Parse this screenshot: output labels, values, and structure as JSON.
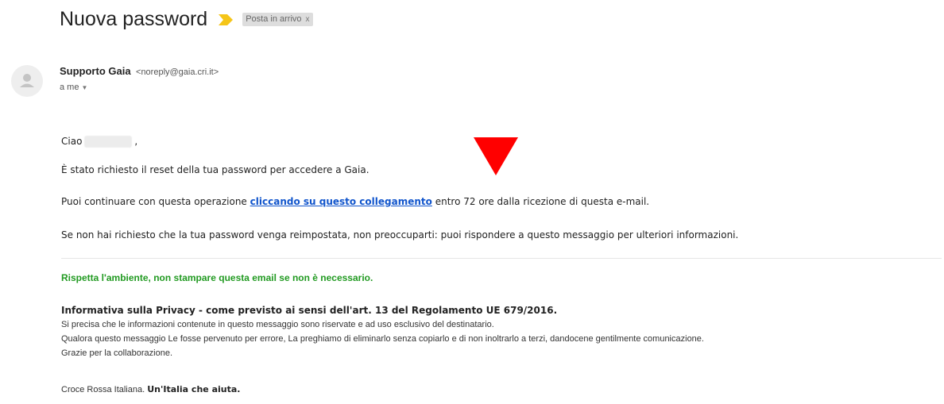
{
  "email": {
    "subject": "Nuova password",
    "label": "Posta in arrivo",
    "label_close": "x",
    "sender_name": "Supporto Gaia",
    "sender_email": "<noreply@gaia.cri.it>",
    "recipient": "a me",
    "body": {
      "greeting": "Ciao",
      "greeting_comma": ",",
      "line1": "È stato richiesto il reset della tua password per accedere a Gaia.",
      "line2_before": "Puoi continuare con questa operazione",
      "line2_link": "cliccando su questo collegamento",
      "line2_after": "entro 72 ore dalla ricezione di questa e-mail.",
      "line3": "Se non hai richiesto che la tua password venga reimpostata, non preoccuparti: puoi rispondere a questo messaggio per ulteriori informazioni."
    },
    "eco_note": "Rispetta l'ambiente, non stampare questa email se non è necessario.",
    "privacy": {
      "heading": "Informativa sulla Privacy - come previsto ai sensi dell'art. 13 del Regolamento UE 679/2016.",
      "line1": "Si precisa che le informazioni contenute in questo messaggio sono riservate e ad uso esclusivo del destinatario.",
      "line2": "Qualora questo messaggio Le fosse pervenuto per errore, La preghiamo di eliminarlo senza copiarlo e di non inoltrarlo a terzi, dandocene gentilmente comunicazione.",
      "line3": "Grazie per la collaborazione."
    },
    "footer_org": "Croce Rossa Italiana.",
    "footer_slogan": "Un'Italia che aiuta."
  },
  "colors": {
    "link": "#1155cc",
    "eco_green": "#219a21",
    "pointer_red": "#ff0000",
    "important_marker": "#f5c518"
  },
  "icons": {
    "important": "important-marker-icon",
    "avatar": "default-avatar-icon",
    "pointer": "red-triangle-pointer-icon"
  }
}
